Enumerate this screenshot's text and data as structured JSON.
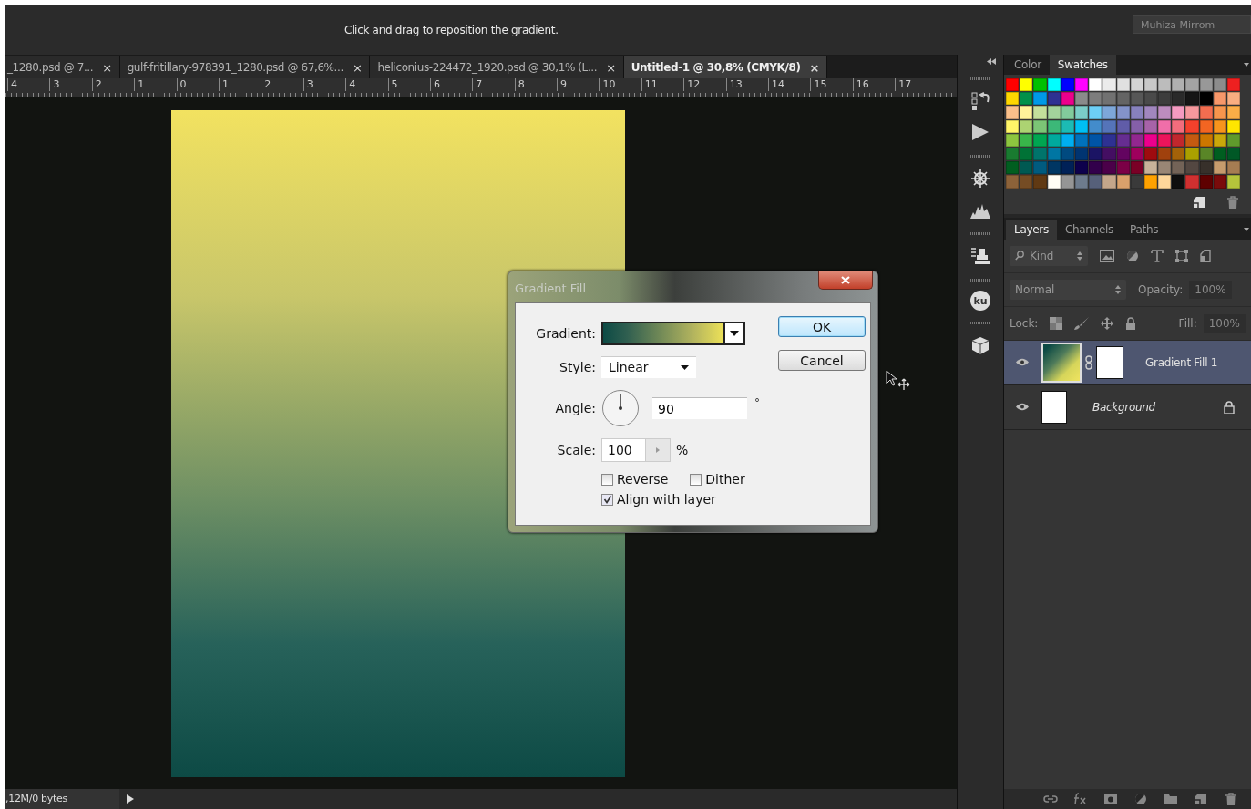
{
  "status_message": "Click and drag to reposition the gradient.",
  "user_field": {
    "value": "Muhiza Mirrom"
  },
  "document_tabs": [
    {
      "label": "_1280.psd @ 7...",
      "close": "×",
      "selected": false
    },
    {
      "label": "gulf-fritillary-978391_1280.psd @ 67,6%...",
      "close": "×",
      "selected": false
    },
    {
      "label": "heliconius-224472_1920.psd @ 30,1% (L...",
      "close": "×",
      "selected": false
    },
    {
      "label": "Untitled-1 @ 30,8% (CMYK/8)",
      "close": "×",
      "selected": true
    }
  ],
  "ruler": {
    "labels": [
      "4",
      "3",
      "2",
      "1",
      "0",
      "1",
      "2",
      "3",
      "4",
      "5",
      "6",
      "7",
      "8",
      "9",
      "10",
      "11",
      "12",
      "13",
      "14",
      "15",
      "16",
      "17"
    ]
  },
  "status_bar": {
    "text": ",12M/0 bytes"
  },
  "dialog": {
    "title": "Gradient Fill",
    "gradient_label": "Gradient:",
    "style_label": "Style:",
    "style_value": "Linear",
    "angle_label": "Angle:",
    "angle_value": "90",
    "degree_sign": "°",
    "scale_label": "Scale:",
    "scale_value": "100",
    "percent_sign": "%",
    "checkboxes": [
      {
        "label": "Reverse",
        "checked": false
      },
      {
        "label": "Dither",
        "checked": false
      },
      {
        "label": "Align with layer",
        "checked": true
      }
    ],
    "buttons": [
      {
        "label": "OK",
        "kind": "default"
      },
      {
        "label": "Cancel",
        "kind": "normal"
      }
    ]
  },
  "panel_strip": {
    "badge": "ku"
  },
  "swatches_panel": {
    "tabs": [
      {
        "label": "Color",
        "selected": false
      },
      {
        "label": "Swatches",
        "selected": true
      }
    ],
    "swatches": [
      {
        "color": "#ff0000"
      },
      {
        "color": "#ffff00"
      },
      {
        "color": "#00c000"
      },
      {
        "color": "#00ffff"
      },
      {
        "color": "#0000ff"
      },
      {
        "color": "#ff00ff"
      },
      {
        "color": "#ffffff"
      },
      {
        "color": "#ebebeb"
      },
      {
        "color": "#e0e0e0"
      },
      {
        "color": "#d4d4d4"
      },
      {
        "color": "#c8c8c8"
      },
      {
        "color": "#bcbcbc"
      },
      {
        "color": "#b0b0b0"
      },
      {
        "color": "#a4a4a4"
      },
      {
        "color": "#989898"
      },
      {
        "color": "#8c8c8c"
      },
      {
        "color": "#ee2020"
      },
      {
        "color": "#ffd700"
      },
      {
        "color": "#00904a"
      },
      {
        "color": "#0099e6"
      },
      {
        "color": "#2e3192"
      },
      {
        "color": "#ec008c"
      },
      {
        "color": "#8a8a8a"
      },
      {
        "color": "#7d7d7d"
      },
      {
        "color": "#717171"
      },
      {
        "color": "#646464"
      },
      {
        "color": "#575757"
      },
      {
        "color": "#4a4a4a"
      },
      {
        "color": "#3d3d3d"
      },
      {
        "color": "#2a2a2a"
      },
      {
        "color": "#151515"
      },
      {
        "color": "#000000"
      },
      {
        "color": "#f7976a"
      },
      {
        "color": "#f9ad81"
      },
      {
        "color": "#fbc08a"
      },
      {
        "color": "#fff29a"
      },
      {
        "color": "#c4df9b"
      },
      {
        "color": "#a3d39c"
      },
      {
        "color": "#82ca9c"
      },
      {
        "color": "#7bcdc8"
      },
      {
        "color": "#6dcff6"
      },
      {
        "color": "#7da7d9"
      },
      {
        "color": "#8393ca"
      },
      {
        "color": "#8781bd"
      },
      {
        "color": "#a186be"
      },
      {
        "color": "#bd8cbf"
      },
      {
        "color": "#f49ac1"
      },
      {
        "color": "#f5989d"
      },
      {
        "color": "#f26d50"
      },
      {
        "color": "#f7954d"
      },
      {
        "color": "#fbad47"
      },
      {
        "color": "#fff568"
      },
      {
        "color": "#acd372"
      },
      {
        "color": "#7cc576"
      },
      {
        "color": "#3cb878"
      },
      {
        "color": "#1cbbb4"
      },
      {
        "color": "#00bff3"
      },
      {
        "color": "#438ccb"
      },
      {
        "color": "#5574b9"
      },
      {
        "color": "#605ca8"
      },
      {
        "color": "#855fa8"
      },
      {
        "color": "#a763a8"
      },
      {
        "color": "#f06ea9"
      },
      {
        "color": "#f26d7d"
      },
      {
        "color": "#f4412c"
      },
      {
        "color": "#f26522"
      },
      {
        "color": "#f7941d"
      },
      {
        "color": "#ffe600"
      },
      {
        "color": "#8dc63f"
      },
      {
        "color": "#39b54a"
      },
      {
        "color": "#00a651"
      },
      {
        "color": "#00a99d"
      },
      {
        "color": "#00aeef"
      },
      {
        "color": "#0072bc"
      },
      {
        "color": "#0054a6"
      },
      {
        "color": "#2e3192"
      },
      {
        "color": "#662d91"
      },
      {
        "color": "#92278f"
      },
      {
        "color": "#ec008c"
      },
      {
        "color": "#ed145b"
      },
      {
        "color": "#c1272d"
      },
      {
        "color": "#c55a11"
      },
      {
        "color": "#cc7700"
      },
      {
        "color": "#c9a80a"
      },
      {
        "color": "#5f9a2c"
      },
      {
        "color": "#197b30"
      },
      {
        "color": "#007236"
      },
      {
        "color": "#00746b"
      },
      {
        "color": "#0076a3"
      },
      {
        "color": "#004a80"
      },
      {
        "color": "#003471"
      },
      {
        "color": "#1b1464"
      },
      {
        "color": "#440e62"
      },
      {
        "color": "#630460"
      },
      {
        "color": "#9e005d"
      },
      {
        "color": "#9e0b0f"
      },
      {
        "color": "#a0410d"
      },
      {
        "color": "#a36209"
      },
      {
        "color": "#aba000"
      },
      {
        "color": "#598527"
      },
      {
        "color": "#005e20"
      },
      {
        "color": "#005826"
      },
      {
        "color": "#005e20"
      },
      {
        "color": "#005952"
      },
      {
        "color": "#005b7f"
      },
      {
        "color": "#003663"
      },
      {
        "color": "#002157"
      },
      {
        "color": "#0d004c"
      },
      {
        "color": "#32004b"
      },
      {
        "color": "#4b0049"
      },
      {
        "color": "#7b0046"
      },
      {
        "color": "#7a0026"
      },
      {
        "color": "#c7b299"
      },
      {
        "color": "#998675"
      },
      {
        "color": "#736357"
      },
      {
        "color": "#534741"
      },
      {
        "color": "#37302a"
      },
      {
        "color": "#c69c6d"
      },
      {
        "color": "#a67c52"
      },
      {
        "color": "#8c6239"
      },
      {
        "color": "#754c24"
      },
      {
        "color": "#603913"
      },
      {
        "color": "#fffdf5"
      },
      {
        "color": "#959595"
      },
      {
        "color": "#6d7b8d"
      },
      {
        "color": "#56607a"
      },
      {
        "color": "#c4a68a"
      },
      {
        "color": "#d9a06b"
      },
      {
        "color": "#3a3a3a"
      },
      {
        "color": "#ffa200"
      },
      {
        "color": "#fdd69a"
      },
      {
        "color": "#0e0e0e"
      },
      {
        "color": "#d03030"
      },
      {
        "color": "#5e0000"
      },
      {
        "color": "#7a0b0b"
      },
      {
        "color": "#b5c43b"
      }
    ]
  },
  "layers_panel": {
    "tabs": [
      {
        "label": "Layers",
        "selected": true
      },
      {
        "label": "Channels",
        "selected": false
      },
      {
        "label": "Paths",
        "selected": false
      }
    ],
    "filter": {
      "value": "Kind"
    },
    "blend_mode": {
      "value": "Normal"
    },
    "opacity_label": "Opacity:",
    "opacity_value": "100%",
    "lock_label": "Lock:",
    "fill_label": "Fill:",
    "fill_value": "100%",
    "layers": [
      {
        "name": "Gradient Fill 1",
        "kind": "fill",
        "selected": true,
        "visible": true,
        "locked": false
      },
      {
        "name": "Background",
        "kind": "background",
        "selected": false,
        "visible": true,
        "locked": true
      }
    ]
  }
}
